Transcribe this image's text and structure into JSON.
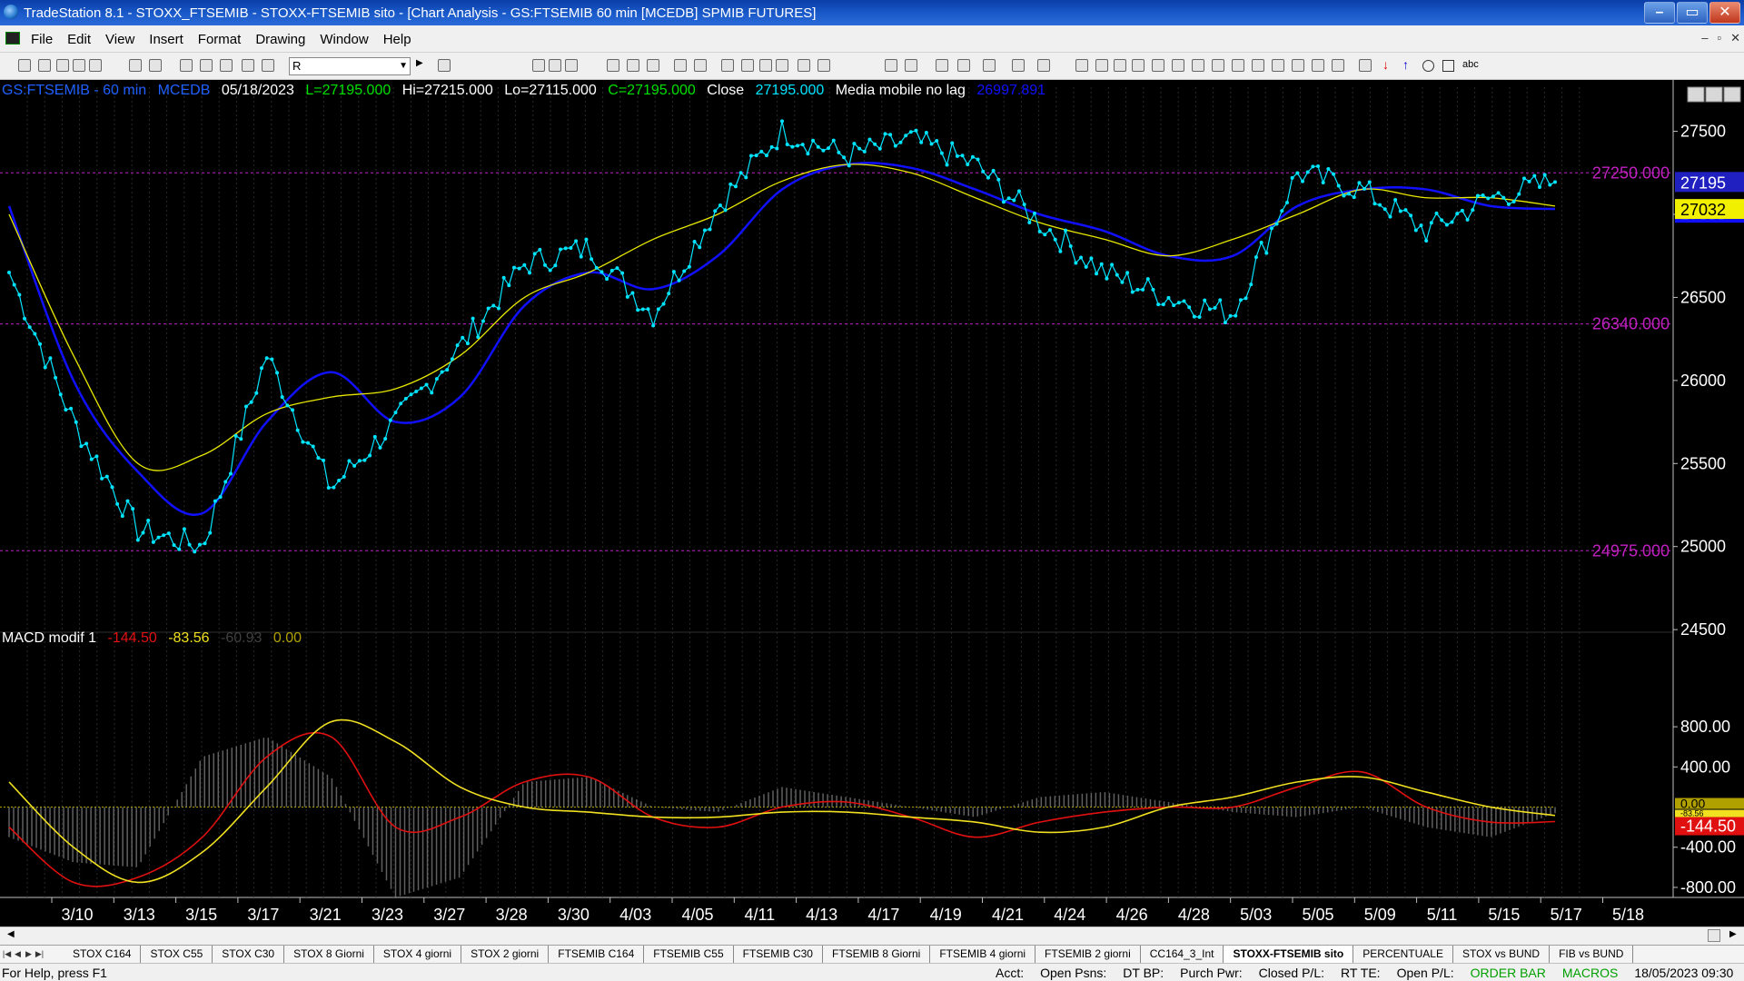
{
  "window": {
    "title": "TradeStation 8.1 - STOXX_FTSEMIB - STOXX-FTSEMIB sito - [Chart Analysis - GS:FTSEMIB  60 min  [MCEDB] SPMIB FUTURES]",
    "minimize": "–",
    "maximize": "▭",
    "close": "✕"
  },
  "menu": {
    "items": [
      "File",
      "Edit",
      "View",
      "Insert",
      "Format",
      "Drawing",
      "Window",
      "Help"
    ],
    "mdi_minimize": "–",
    "mdi_restore": "▫",
    "mdi_close": "✕"
  },
  "toolbar": {
    "symbol_value": "R",
    "dropdown_glyph": "▼",
    "arrow_glyph": "▶",
    "abc_label": "abc"
  },
  "chart_header": {
    "symbol": "GS:FTSEMIB - 60 min",
    "datafeed": "MCEDB",
    "date": "05/18/2023",
    "last": "L=27195.000",
    "high": "Hi=27215.000",
    "low": "Lo=27115.000",
    "close": "C=27195.000",
    "close_label": "Close",
    "close_value": "27195.000",
    "ma_label": "Media mobile no lag",
    "ma_value": "26997.891"
  },
  "macd_header": {
    "label": "MACD modif 1",
    "v1": "-144.50",
    "v2": "-83.56",
    "v3": "-60.93",
    "v4": "0.00"
  },
  "price_levels": [
    {
      "label": "27250.000",
      "value": 27250
    },
    {
      "label": "26340.000",
      "value": 26340
    },
    {
      "label": "24975.000",
      "value": 24975
    }
  ],
  "price_badges": {
    "last": "27195",
    "ma": "27032"
  },
  "macd_badges": {
    "zero": "0.00",
    "value": "-144.50",
    "value2": "-83.56"
  },
  "colors": {
    "price": "#00e5ff",
    "ma_blue": "#1010ff",
    "ma_yellow": "#e8e800",
    "macd_red": "#e01010",
    "macd_yellow": "#f0e020",
    "histogram": "#808080",
    "levels": "#c020c0",
    "header_green": "#00e000",
    "header_blue": "#2060ff"
  },
  "chart_data": [
    {
      "type": "line",
      "title": "GS:FTSEMIB - 60 min",
      "ylim": [
        24200,
        27700
      ],
      "yticks": [
        24500,
        25000,
        25500,
        26000,
        26500,
        27000,
        27500
      ],
      "ytick_labels": [
        "24500",
        "25000",
        "25500",
        "26000",
        "26500",
        "27000",
        "27500"
      ],
      "xtick_labels": [
        "3/10",
        "3/13",
        "3/15",
        "3/17",
        "3/21",
        "3/23",
        "3/27",
        "3/28",
        "3/30",
        "4/03",
        "4/05",
        "4/11",
        "4/13",
        "4/17",
        "4/19",
        "4/21",
        "4/24",
        "4/26",
        "4/28",
        "5/03",
        "5/05",
        "5/09",
        "5/11",
        "5/15",
        "5/17",
        "5/18"
      ],
      "categories": [
        "3/10",
        "3/13",
        "3/15",
        "3/17",
        "3/21",
        "3/23",
        "3/27",
        "3/28",
        "3/30",
        "4/03",
        "4/05",
        "4/11",
        "4/13",
        "4/17",
        "4/19",
        "4/21",
        "4/24",
        "4/26",
        "4/28",
        "5/03",
        "5/05",
        "5/09",
        "5/11",
        "5/15",
        "5/17"
      ],
      "series": [
        {
          "name": "Close",
          "values": [
            26650,
            25750,
            25100,
            25000,
            26150,
            25350,
            25750,
            26200,
            26700,
            26800,
            26400,
            27050,
            27500,
            27350,
            27450,
            27300,
            26950,
            26650,
            26500,
            26400,
            27250,
            27150,
            26900,
            27100,
            27195
          ]
        },
        {
          "name": "Media mobile no lag",
          "values": [
            27050,
            26000,
            25450,
            25200,
            25750,
            26050,
            25750,
            25900,
            26450,
            26650,
            26550,
            26750,
            27150,
            27300,
            27280,
            27150,
            27000,
            26900,
            26750,
            26750,
            27050,
            27150,
            27150,
            27050,
            27032
          ]
        },
        {
          "name": "",
          "values": [
            27000,
            26150,
            25500,
            25550,
            25800,
            25900,
            25950,
            26150,
            26500,
            26650,
            26850,
            27000,
            27200,
            27300,
            27250,
            27100,
            26950,
            26850,
            26750,
            26850,
            27000,
            27150,
            27100,
            27100,
            27050
          ]
        }
      ]
    },
    {
      "type": "line",
      "title": "MACD modif 1",
      "ylim": [
        -900,
        1000
      ],
      "yticks": [
        -800,
        -400,
        0,
        400,
        800
      ],
      "ytick_labels": [
        "-800.00",
        "-400.00",
        "0.00",
        "400.00",
        "800.00"
      ],
      "categories": [
        "3/10",
        "3/13",
        "3/15",
        "3/17",
        "3/21",
        "3/23",
        "3/27",
        "3/28",
        "3/30",
        "4/03",
        "4/05",
        "4/11",
        "4/13",
        "4/17",
        "4/19",
        "4/21",
        "4/24",
        "4/26",
        "4/28",
        "5/03",
        "5/05",
        "5/09",
        "5/11",
        "5/15",
        "5/17"
      ],
      "series": [
        {
          "name": "",
          "values": [
            -200,
            -750,
            -700,
            -300,
            500,
            700,
            -200,
            -100,
            250,
            300,
            -100,
            -200,
            0,
            50,
            -100,
            -300,
            -150,
            -50,
            0,
            0,
            200,
            350,
            0,
            -150,
            -144.5
          ]
        },
        {
          "name": "",
          "values": [
            250,
            -400,
            -750,
            -450,
            200,
            850,
            650,
            200,
            0,
            -50,
            -100,
            -100,
            -50,
            -50,
            -100,
            -150,
            -250,
            -200,
            0,
            100,
            250,
            300,
            150,
            0,
            -83.56
          ]
        },
        {
          "name": "",
          "values": [
            -300,
            -550,
            -600,
            500,
            700,
            300,
            -900,
            -700,
            250,
            300,
            0,
            -50,
            200,
            100,
            0,
            -100,
            100,
            150,
            50,
            -50,
            -100,
            0,
            -200,
            -300,
            -60.93
          ]
        }
      ]
    }
  ]
}
